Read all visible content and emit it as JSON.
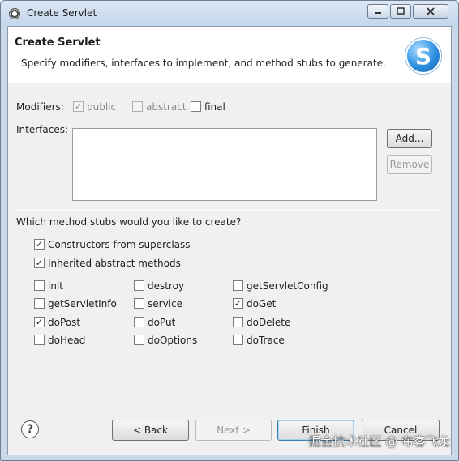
{
  "window": {
    "title": "Create Servlet"
  },
  "header": {
    "title": "Create Servlet",
    "description": "Specify modifiers, interfaces to implement, and method stubs to generate.",
    "logo_letter": "S"
  },
  "modifiers": {
    "label": "Modifiers:",
    "public": {
      "label": "public",
      "checked": true,
      "enabled": false
    },
    "abstract": {
      "label": "abstract",
      "checked": false,
      "enabled": false
    },
    "final": {
      "label": "final",
      "checked": false,
      "enabled": true
    }
  },
  "interfaces": {
    "label": "Interfaces:",
    "add_label": "Add...",
    "remove_label": "Remove"
  },
  "stubs": {
    "question": "Which method stubs would you like to create?",
    "constructors": {
      "label": "Constructors from superclass",
      "checked": true
    },
    "inherited": {
      "label": "Inherited abstract methods",
      "checked": true
    },
    "methods": [
      {
        "label": "init",
        "checked": false
      },
      {
        "label": "destroy",
        "checked": false
      },
      {
        "label": "getServletConfig",
        "checked": false
      },
      {
        "label": "getServletInfo",
        "checked": false
      },
      {
        "label": "service",
        "checked": false
      },
      {
        "label": "doGet",
        "checked": true
      },
      {
        "label": "doPost",
        "checked": true
      },
      {
        "label": "doPut",
        "checked": false
      },
      {
        "label": "doDelete",
        "checked": false
      },
      {
        "label": "doHead",
        "checked": false
      },
      {
        "label": "doOptions",
        "checked": false
      },
      {
        "label": "doTrace",
        "checked": false
      }
    ]
  },
  "footer": {
    "help_icon": "?",
    "back_label": "< Back",
    "next_label": "Next >",
    "finish_label": "Finish",
    "cancel_label": "Cancel"
  },
  "watermark": "掘金技术社区 @ 布客飞龙",
  "check_glyph": "✓"
}
